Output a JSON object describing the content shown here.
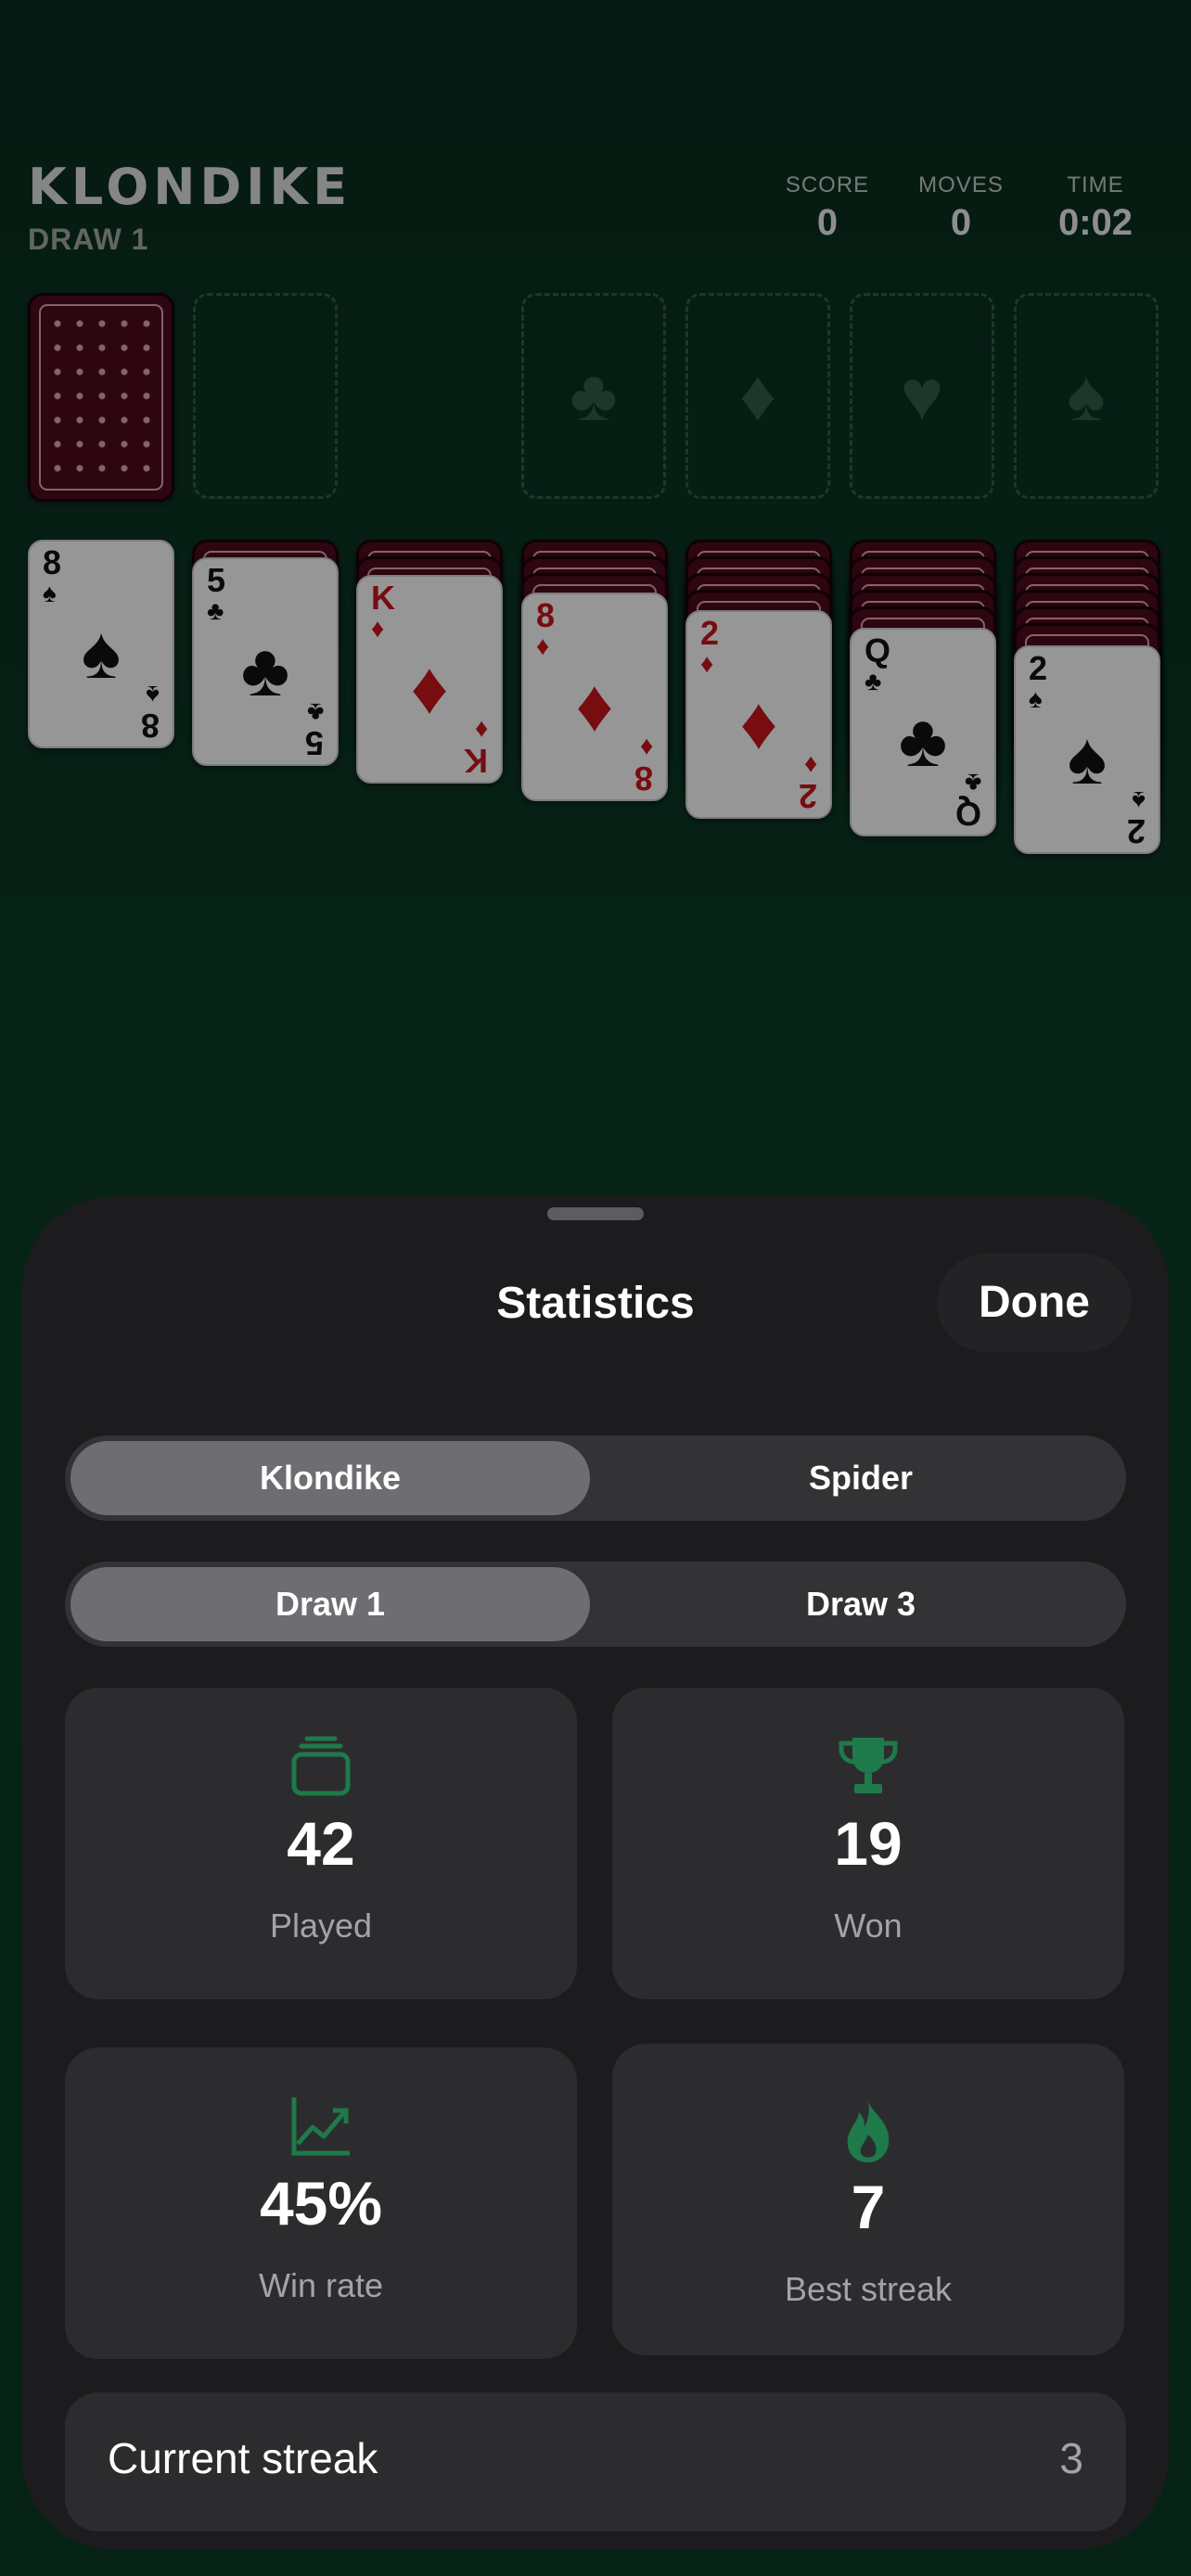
{
  "game": {
    "title": "KLONDIKE",
    "mode": "DRAW 1",
    "score": {
      "label": "SCORE",
      "value": "0"
    },
    "moves": {
      "label": "MOVES",
      "value": "0"
    },
    "time": {
      "label": "TIME",
      "value": "0:02"
    },
    "foundations": [
      "♣",
      "♦",
      "♥",
      "♠"
    ],
    "tableau": [
      {
        "face_down": 0,
        "rank": "8",
        "suit": "♠",
        "color": "black"
      },
      {
        "face_down": 1,
        "rank": "5",
        "suit": "♣",
        "color": "black"
      },
      {
        "face_down": 2,
        "rank": "K",
        "suit": "♦",
        "color": "red"
      },
      {
        "face_down": 3,
        "rank": "8",
        "suit": "♦",
        "color": "red"
      },
      {
        "face_down": 4,
        "rank": "2",
        "suit": "♦",
        "color": "red"
      },
      {
        "face_down": 5,
        "rank": "Q",
        "suit": "♣",
        "color": "black"
      },
      {
        "face_down": 6,
        "rank": "2",
        "suit": "♠",
        "color": "black"
      }
    ]
  },
  "sheet": {
    "title": "Statistics",
    "done_label": "Done",
    "game_tabs": [
      "Klondike",
      "Spider"
    ],
    "draw_tabs": [
      "Draw 1",
      "Draw 3"
    ],
    "tiles": [
      {
        "icon": "stack-icon",
        "value": "42",
        "caption": "Played"
      },
      {
        "icon": "trophy-icon",
        "value": "19",
        "caption": "Won"
      },
      {
        "icon": "chart-icon",
        "value": "45%",
        "caption": "Win rate"
      },
      {
        "icon": "flame-icon",
        "value": "7",
        "caption": "Best streak"
      }
    ],
    "current_streak": {
      "label": "Current streak",
      "value": "3"
    },
    "accent": "#1e7a4a"
  }
}
